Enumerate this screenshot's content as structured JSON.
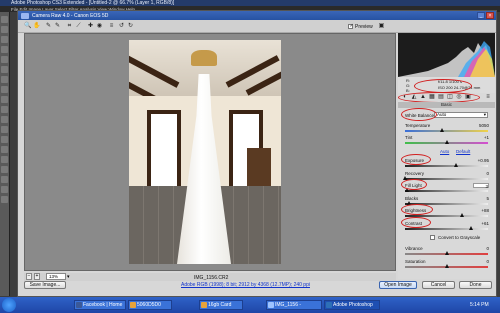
{
  "photoshop": {
    "title": "Adobe Photoshop CS3 Extended - [Untitled-2 @ 66.7% (Layer 1, RGB/8)]",
    "menu": "File  Edit  Image  Layer  Select  Filter  Analysis  View  Window  Help"
  },
  "dialog": {
    "title": "Camera Raw 4.0  -  Canon EOS 5D",
    "preview_label": "Preview",
    "preview_checked": true
  },
  "readout": {
    "rgb": [
      "R:",
      "G:",
      "B:"
    ],
    "exif": [
      "f/11.8   1/100 s",
      "ISO 200   24-70@24 mm"
    ]
  },
  "panel": {
    "section": "Basic",
    "white_balance": {
      "label": "White Balance:",
      "value": "Auto"
    },
    "auto_link": "Auto",
    "default_link": "Default",
    "convert_grayscale": "Convert to Grayscale",
    "sliders": [
      {
        "label": "Temperature",
        "value": "5050",
        "pos": 0.45
      },
      {
        "label": "Tint",
        "value": "+1",
        "pos": 0.5
      },
      {
        "label": "Exposure",
        "value": "+0.95",
        "pos": 0.62
      },
      {
        "label": "Recovery",
        "value": "0",
        "pos": 0.0
      },
      {
        "label": "Fill Light",
        "value": "3",
        "pos": 0.03
      },
      {
        "label": "Blacks",
        "value": "5",
        "pos": 0.05
      },
      {
        "label": "Brightness",
        "value": "+88",
        "pos": 0.69
      },
      {
        "label": "Contrast",
        "value": "+61",
        "pos": 0.8
      },
      {
        "label": "Vibrance",
        "value": "0",
        "pos": 0.5
      },
      {
        "label": "Saturation",
        "value": "0",
        "pos": 0.5
      }
    ]
  },
  "zoom": {
    "value": "13%"
  },
  "filename": "IMG_1156.CR2",
  "workflow_link": "Adobe RGB (1998); 8 bit; 2912 by 4368 (12.7MP); 240 ppi",
  "buttons": {
    "save": "Save Image...",
    "open": "Open Image",
    "cancel": "Cancel",
    "done": "Done"
  },
  "taskbar": {
    "items": [
      {
        "label": "Facebook | Home - ...",
        "color": "#3b5998"
      },
      {
        "label": "5060D5D0",
        "color": "#e8a33a"
      },
      {
        "label": "16gb Card",
        "color": "#e8a33a"
      },
      {
        "label": "IMG_1156 - Window...",
        "color": "#9ec4ff"
      },
      {
        "label": "Adobe Photoshop C...",
        "color": "#2d6fb7"
      }
    ],
    "clock": "5:14 PM"
  }
}
